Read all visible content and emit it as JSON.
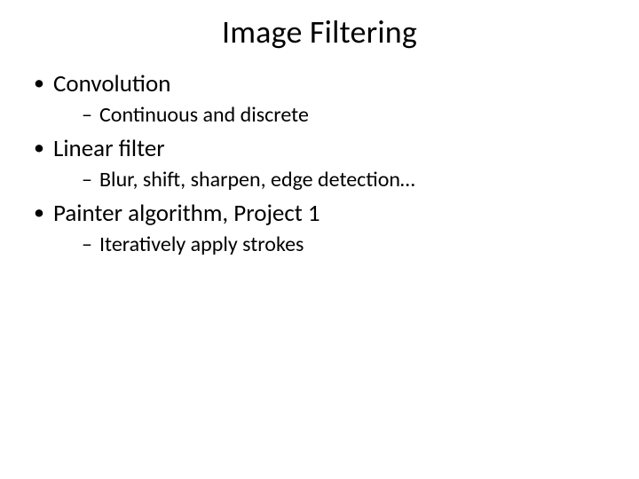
{
  "slide": {
    "title": "Image Filtering",
    "bullets": [
      {
        "text": "Convolution",
        "sub": [
          "Continuous and discrete"
        ]
      },
      {
        "text": "Linear filter",
        "sub": [
          "Blur, shift, sharpen, edge detection…"
        ]
      },
      {
        "text": "Painter algorithm, Project 1",
        "sub": [
          "Iteratively apply strokes"
        ]
      }
    ]
  }
}
